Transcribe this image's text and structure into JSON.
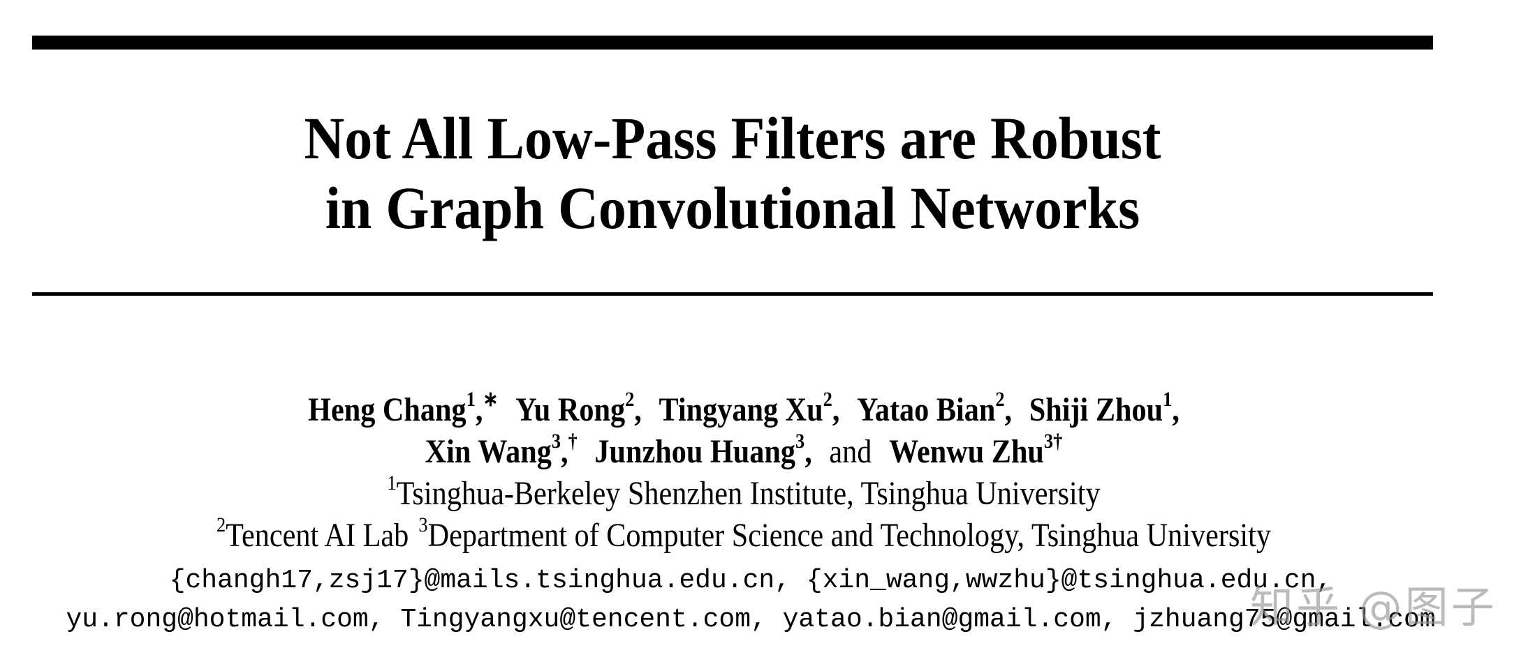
{
  "paper": {
    "title_lines": [
      "Not All Low-Pass Filters are Robust",
      "in Graph Convolutional Networks"
    ],
    "authors_line1": [
      {
        "name": "Heng Chang",
        "mark": "1",
        "note": "∗",
        "sep": ","
      },
      {
        "name": "Yu Rong",
        "mark": "2",
        "note": "",
        "sep": ","
      },
      {
        "name": "Tingyang Xu",
        "mark": "2",
        "note": "",
        "sep": ","
      },
      {
        "name": "Yatao Bian",
        "mark": "2",
        "note": "",
        "sep": ","
      },
      {
        "name": "Shiji Zhou",
        "mark": "1",
        "note": "",
        "sep": ","
      }
    ],
    "authors_line2": [
      {
        "name": "Xin Wang",
        "mark": "3",
        "note": "†",
        "sep": ","
      },
      {
        "name": "Junzhou Huang",
        "mark": "3",
        "note": "",
        "sep": ","
      },
      {
        "name": "Wenwu Zhu",
        "mark": "3",
        "note": "†",
        "sep": ""
      }
    ],
    "and_word": "and",
    "affiliations": [
      {
        "mark": "1",
        "text": "Tsinghua-Berkeley Shenzhen Institute, Tsinghua University"
      },
      {
        "mark": "2",
        "text": "Tencent AI Lab"
      },
      {
        "mark": "3",
        "text": "Department of Computer Science and Technology, Tsinghua University"
      }
    ],
    "email_lines": [
      "{changh17,zsj17}@mails.tsinghua.edu.cn, {xin_wang,wwzhu}@tsinghua.edu.cn,",
      "yu.rong@hotmail.com, Tingyangxu@tencent.com, yatao.bian@gmail.com, jzhuang75@gmail.com"
    ]
  },
  "watermark": "知乎 @图子"
}
